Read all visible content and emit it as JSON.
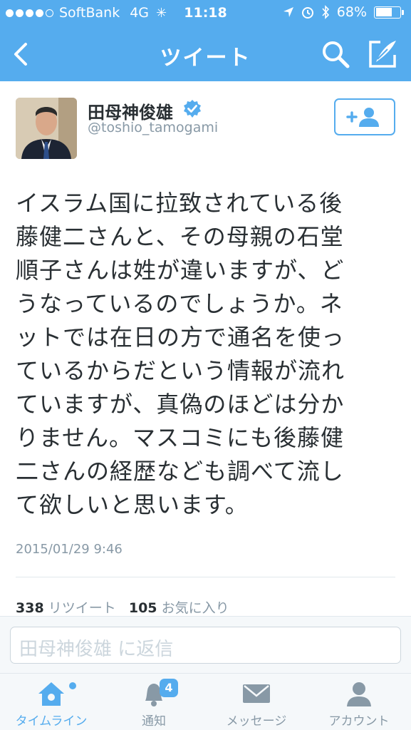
{
  "status_bar": {
    "carrier": "SoftBank",
    "network": "4G",
    "time": "11:18",
    "battery": "68%",
    "battery_level": 0.68
  },
  "nav": {
    "title": "ツイート",
    "back_icon": "chevron-left-icon",
    "search_icon": "search-icon",
    "compose_icon": "compose-icon"
  },
  "tweet": {
    "author_name": "田母神俊雄",
    "handle": "@toshio_tamogami",
    "verified": true,
    "text_lines": [
      "イスラム国に拉致されている後",
      "藤健二さんと、その母親の石堂",
      "順子さんは姓が違いますが、ど",
      "うなっているのでしょうか。ネ",
      "ットでは在日の方で通名を使っ",
      "ているからだという情報が流れ",
      "ていますが、真偽のほどは分か",
      "りません。マスコミにも後藤健",
      "二さんの経歴なども調べて流し",
      "て欲しいと思います。"
    ],
    "timestamp": "2015/01/29 9:46",
    "retweet_count": "338",
    "retweet_label": "リツイート",
    "favorite_count": "105",
    "favorite_label": "お気に入り"
  },
  "reply": {
    "placeholder": "田母神俊雄 に返信"
  },
  "tabs": [
    {
      "label": "タイムライン",
      "icon": "home-icon",
      "active": true
    },
    {
      "label": "通知",
      "icon": "bell-icon",
      "badge": "4",
      "active": false
    },
    {
      "label": "メッセージ",
      "icon": "envelope-icon",
      "active": false
    },
    {
      "label": "アカウント",
      "icon": "person-icon",
      "active": false
    }
  ],
  "colors": {
    "brand": "#55acee",
    "text": "#292f33",
    "muted": "#8899a6"
  }
}
